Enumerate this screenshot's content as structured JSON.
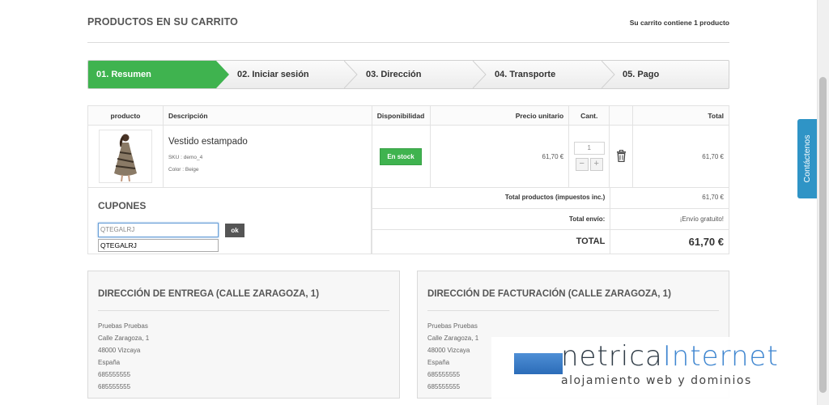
{
  "header": {
    "title": "PRODUCTOS EN SU CARRITO",
    "cart_count": "Su carrito contiene 1 producto"
  },
  "steps": [
    {
      "label": "01. Resumen",
      "active": true
    },
    {
      "label": "02. Iniciar sesión",
      "active": false
    },
    {
      "label": "03. Dirección",
      "active": false
    },
    {
      "label": "04. Transporte",
      "active": false
    },
    {
      "label": "05. Pago",
      "active": false
    }
  ],
  "table": {
    "columns": [
      "producto",
      "Descripción",
      "Disponibilidad",
      "Precio unitario",
      "Cant.",
      "",
      "Total"
    ],
    "row": {
      "name": "Vestido estampado",
      "sku": "SKU : demo_4",
      "color": "Color : Beige",
      "availability": "En stock",
      "unit_price": "61,70 €",
      "qty": "1",
      "qty_minus": "−",
      "qty_plus": "+",
      "total": "61,70 €",
      "delete_icon": "trash-icon"
    }
  },
  "coupons": {
    "title": "CUPONES",
    "input_value": "QTEGALRJ",
    "ok_label": "ok",
    "suggestion": "QTEGALRJ"
  },
  "totals": {
    "products_label": "Total productos (impuestos inc.)",
    "products_value": "61,70 €",
    "shipping_label": "Total envío:",
    "shipping_value": "¡Envío gratuito!",
    "total_label": "TOTAL",
    "total_value": "61,70 €"
  },
  "delivery": {
    "title": "DIRECCIÓN DE ENTREGA (CALLE ZARAGOZA, 1)",
    "lines": [
      "Pruebas Pruebas",
      "Calle Zaragoza, 1",
      "48000 Vizcaya",
      "España",
      "685555555",
      "685555555"
    ]
  },
  "billing": {
    "title": "DIRECCIÓN DE FACTURACIÓN (CALLE ZARAGOZA, 1)",
    "lines": [
      "Pruebas Pruebas",
      "Calle Zaragoza, 1",
      "48000 Vizcaya",
      "España",
      "685555555",
      "685555555"
    ]
  },
  "contact_tab": "Contáctenos",
  "watermark": {
    "name_a": "netrica",
    "name_b": "Internet",
    "subtitle": "alojamiento web y dominios"
  },
  "colors": {
    "accent_green": "#3fb34f",
    "contact_blue": "#2f94c6"
  }
}
